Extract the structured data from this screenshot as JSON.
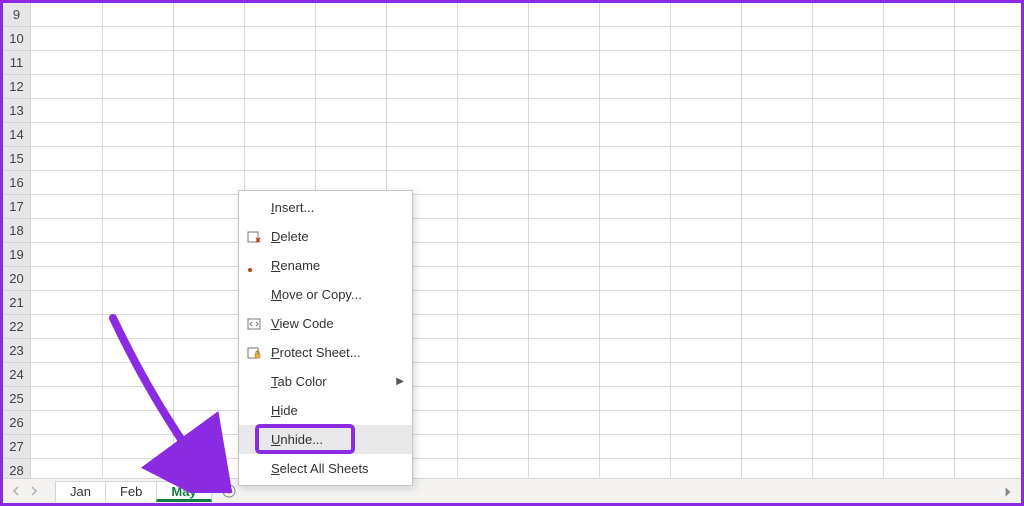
{
  "rows": [
    9,
    10,
    11,
    12,
    13,
    14,
    15,
    16,
    17,
    18,
    19,
    20,
    21,
    22,
    23,
    24,
    25,
    26,
    27,
    28
  ],
  "columnPositions": [
    71,
    142,
    213,
    284,
    355,
    426,
    497,
    568,
    639,
    710,
    781,
    852,
    923,
    994
  ],
  "tabs": [
    {
      "label": "Jan",
      "active": false
    },
    {
      "label": "Feb",
      "active": false
    },
    {
      "label": "May",
      "active": true
    }
  ],
  "contextMenu": {
    "items": [
      {
        "label": "Insert...",
        "key": "I",
        "icon": ""
      },
      {
        "label": "Delete",
        "key": "D",
        "icon": "delete"
      },
      {
        "label": "Rename",
        "key": "R",
        "icon": "pencil"
      },
      {
        "label": "Move or Copy...",
        "key": "M",
        "icon": ""
      },
      {
        "label": "View Code",
        "key": "V",
        "icon": "viewcode"
      },
      {
        "label": "Protect Sheet...",
        "key": "P",
        "icon": "protect"
      },
      {
        "label": "Tab Color",
        "key": "T",
        "icon": "",
        "submenu": true
      },
      {
        "label": "Hide",
        "key": "H",
        "icon": ""
      },
      {
        "label": "Unhide...",
        "key": "U",
        "icon": "",
        "hover": true
      },
      {
        "label": "Select All Sheets",
        "key": "S",
        "icon": ""
      }
    ]
  }
}
